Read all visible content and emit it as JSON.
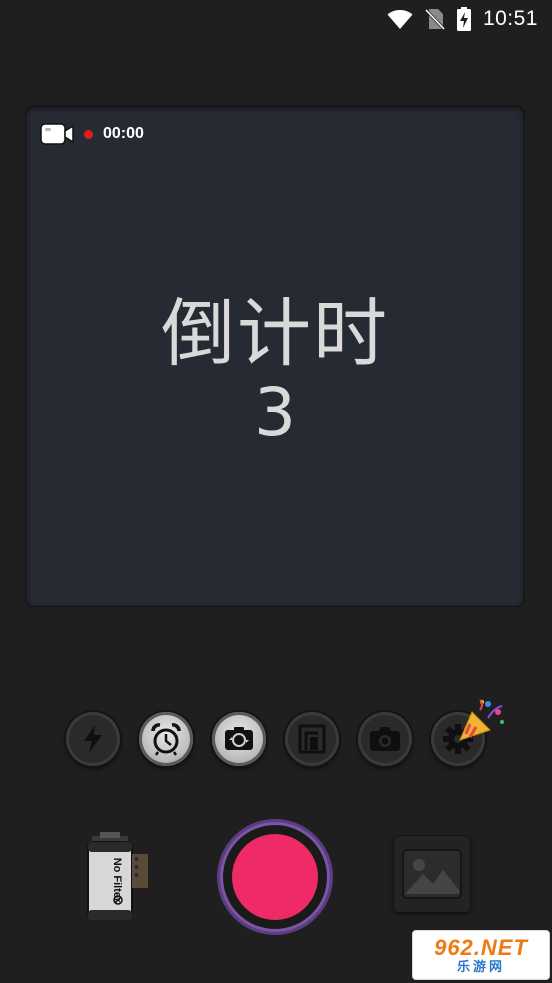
{
  "status_bar": {
    "time": "10:51",
    "icons": [
      "wifi-icon",
      "no-sim-icon",
      "battery-charging-icon"
    ]
  },
  "preview": {
    "recording_icon": "video-camera-icon",
    "recording_time": "00:00",
    "countdown_label": "倒计时",
    "countdown_value": "3",
    "colors": {
      "background": "#262a33",
      "record_dot": "#e51a1a"
    }
  },
  "toolbar": {
    "buttons": [
      {
        "name": "flash",
        "icon": "flash-icon"
      },
      {
        "name": "timer",
        "icon": "alarm-clock-icon"
      },
      {
        "name": "switch-camera",
        "icon": "switch-camera-icon"
      },
      {
        "name": "aspect-ratio",
        "icon": "aspect-ratio-icon"
      },
      {
        "name": "photo-mode",
        "icon": "camera-icon"
      },
      {
        "name": "settings",
        "icon": "gear-icon"
      }
    ],
    "badge": "party-popper-icon"
  },
  "bottom": {
    "film_roll_label": "No Filter",
    "shutter_color": "#ee2a67",
    "shutter_ring_color": "#7b55a8",
    "gallery_icon": "image-icon"
  },
  "watermark": {
    "top_text": "962.NET",
    "bottom_text": "乐游网"
  }
}
